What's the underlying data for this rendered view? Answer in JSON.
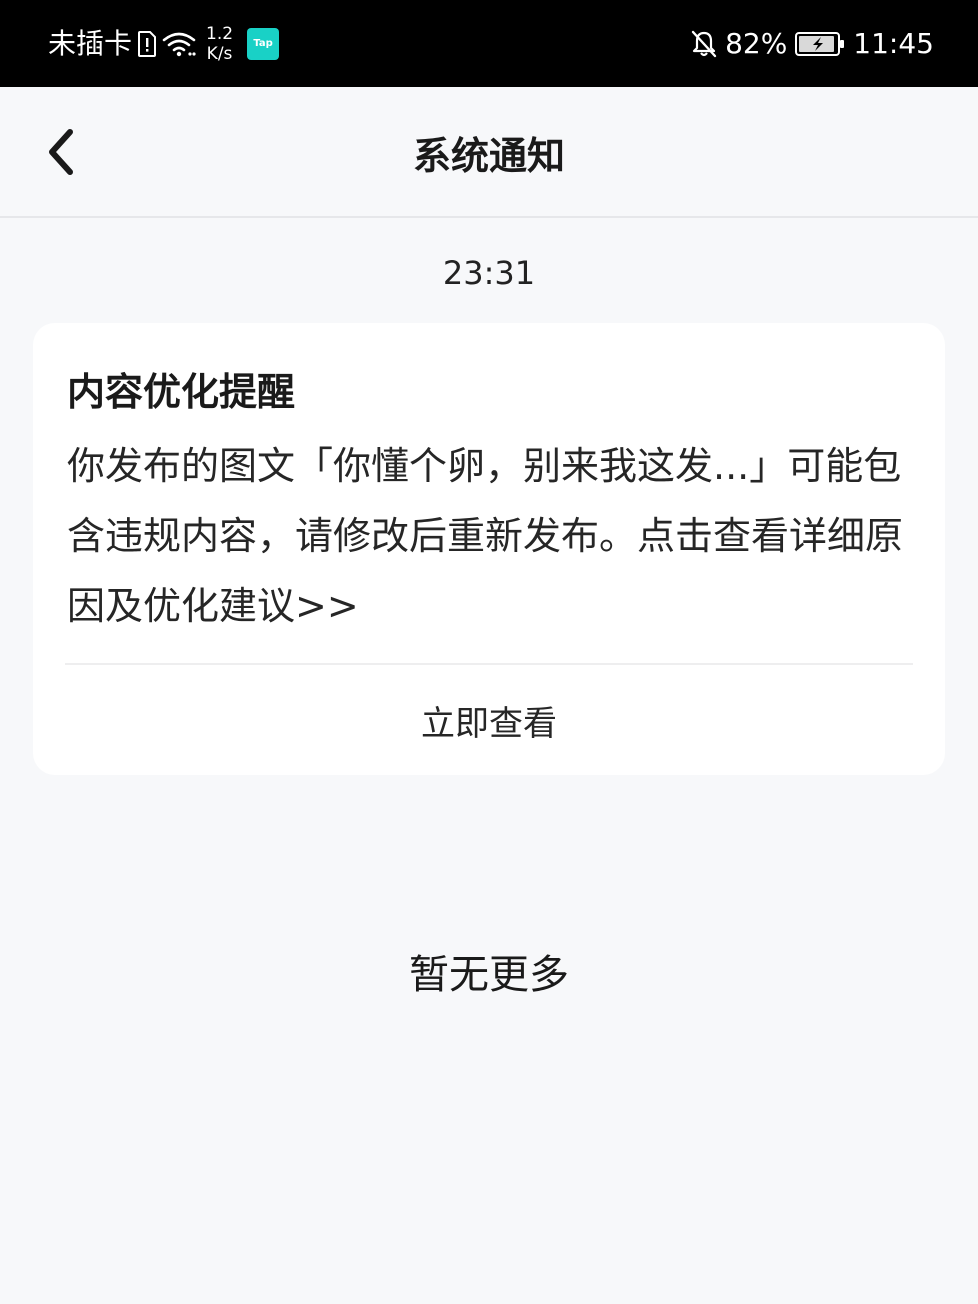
{
  "status_bar": {
    "carrier": "未插卡",
    "speed_value": "1.2",
    "speed_unit": "K/s",
    "tap_label": "Tap",
    "battery_percent": "82%",
    "time": "11:45"
  },
  "nav": {
    "title": "系统通知"
  },
  "notification": {
    "timestamp": "23:31",
    "title": "内容优化提醒",
    "body": "你发布的图文「你懂个卵，别来我这发...」可能包含违规内容，请修改后重新发布。点击查看详细原因及优化建议>>",
    "action_label": "立即查看"
  },
  "footer": {
    "no_more": "暂无更多"
  },
  "colors": {
    "background": "#f7f8fa",
    "card": "#ffffff",
    "status_bar": "#000000",
    "tap_brand": "#19d1c6"
  }
}
